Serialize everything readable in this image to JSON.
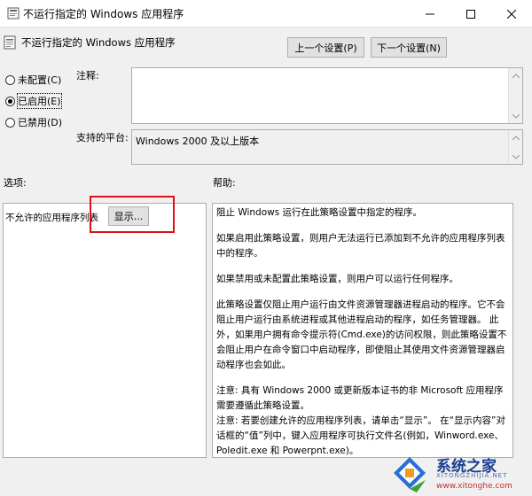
{
  "window": {
    "title": "不运行指定的 Windows 应用程序",
    "controls": [
      "minimize-icon",
      "maximize-icon",
      "close-icon"
    ]
  },
  "header": {
    "policy_title": "不运行指定的 Windows 应用程序",
    "prev_button": "上一个设置(P)",
    "next_button": "下一个设置(N)"
  },
  "state_options": {
    "items": [
      {
        "label": "未配置(C)",
        "checked": false
      },
      {
        "label": "已启用(E)",
        "checked": true
      },
      {
        "label": "已禁用(D)",
        "checked": false
      }
    ]
  },
  "comment": {
    "label": "注释:",
    "value": ""
  },
  "supported": {
    "label": "支持的平台:",
    "value": "Windows 2000 及以上版本"
  },
  "options": {
    "label": "选项:",
    "list_label": "不允许的应用程序列表",
    "show_button": "显示..."
  },
  "help": {
    "label": "帮助:",
    "paragraphs": [
      "阻止 Windows 运行在此策略设置中指定的程序。",
      "如果启用此策略设置，则用户无法运行已添加到不允许的应用程序列表中的程序。",
      "如果禁用或未配置此策略设置，则用户可以运行任何程序。",
      "此策略设置仅阻止用户运行由文件资源管理器进程启动的程序。它不会阻止用户运行由系统进程或其他进程启动的程序，如任务管理器。 此外，如果用户拥有命令提示符(Cmd.exe)的访问权限，则此策略设置不会阻止用户在命令窗口中启动程序，即使阻止其使用文件资源管理器启动程序也会如此。",
      "注意: 具有 Windows 2000 或更新版本证书的非 Microsoft 应用程序需要遵循此策略设置。",
      "注意: 若要创建允许的应用程序列表，请单击“显示”。 在“显示内容”对话框的“值”列中，键入应用程序可执行文件名(例如，Winword.exe、Poledit.exe 和 Powerpnt.exe)。"
    ]
  },
  "watermark": {
    "name": "系统之家",
    "sub": "XITONGZHIJIA.NET",
    "url": "www.xitonghe.com"
  },
  "colors": {
    "highlight": "#e0101a",
    "accent": "#0078d7"
  }
}
